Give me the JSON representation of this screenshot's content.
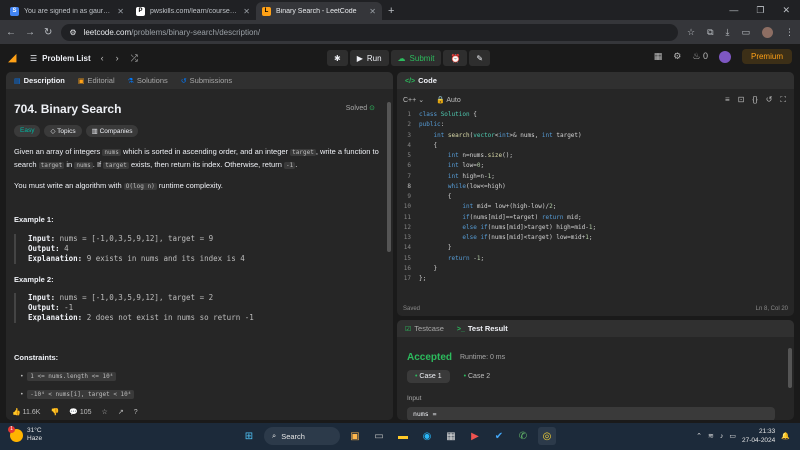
{
  "browser": {
    "tabs": [
      {
        "title": "You are signed in as gaurav.22...",
        "favicon": "S",
        "color": "#4285f4"
      },
      {
        "title": "pwskills.com/learn/course/c-with...",
        "favicon": "P",
        "color": "#ffffff"
      },
      {
        "title": "Binary Search - LeetCode",
        "favicon": "L",
        "color": "#ffa116"
      }
    ],
    "url_host": "leetcode.com",
    "url_path": "/problems/binary-search/description/"
  },
  "nav": {
    "problem_list": "Problem List",
    "run": "Run",
    "submit": "Submit",
    "notif_count": "0",
    "premium": "Premium"
  },
  "left_tabs": {
    "description": "Description",
    "editorial": "Editorial",
    "solutions": "Solutions",
    "submissions": "Submissions"
  },
  "problem": {
    "title": "704. Binary Search",
    "solved": "Solved",
    "tags": [
      "Easy",
      "Topics",
      "Companies"
    ],
    "desc_1": "Given an array of integers",
    "desc_nums": "nums",
    "desc_2": "which is sorted in ascending order, and an integer",
    "desc_target": "target",
    "desc_3": ", write a function to search",
    "desc_4": "in",
    "desc_5": ". If",
    "desc_6": "exists, then return its index. Otherwise, return",
    "desc_neg": "-1",
    "desc_end": ".",
    "desc_p2a": "You must write an algorithm with",
    "desc_big_o": "O(log n)",
    "desc_p2b": "runtime complexity.",
    "ex1_title": "Example 1:",
    "ex1_input": "nums = [-1,0,3,5,9,12], target = 9",
    "ex1_output": "4",
    "ex1_explain": "9 exists in nums and its index is 4",
    "ex2_title": "Example 2:",
    "ex2_input": "nums = [-1,0,3,5,9,12], target = 2",
    "ex2_output": "-1",
    "ex2_explain": "2 does not exist in nums so return -1",
    "label_input": "Input:",
    "label_output": "Output:",
    "label_explain": "Explanation:",
    "constraints_title": "Constraints:",
    "constraint_1": "1 <= nums.length <= 10⁴",
    "constraint_2": "-10⁴ < nums[i], target < 10⁴",
    "likes": "11.6K",
    "comments": "105"
  },
  "code_panel": {
    "title": "Code",
    "language": "C++",
    "mode": "Auto",
    "saved": "Saved",
    "cursor": "Ln 8, Col 20",
    "lines": [
      "class Solution {",
      "public:",
      "    int search(vector<int>& nums, int target)",
      "    {",
      "        int n=nums.size();",
      "        int low=0;",
      "        int high=n-1;",
      "        while(low<=high)",
      "        {",
      "            int mid= low+(high-low)/2;",
      "            if(nums[mid]==target) return mid;",
      "            else if(nums[mid]>target) high=mid-1;",
      "            else if(nums[mid]<target) low=mid+1;",
      "        }",
      "        return -1;",
      "    }",
      "};"
    ]
  },
  "test_panel": {
    "testcase": "Testcase",
    "result": "Test Result",
    "accepted": "Accepted",
    "runtime": "Runtime: 0 ms",
    "case1": "Case 1",
    "case2": "Case 2",
    "input_label": "Input",
    "input_value": "nums ="
  },
  "taskbar": {
    "temp": "31°C",
    "weather": "Haze",
    "badge": "1",
    "search": "Search",
    "time": "21:33",
    "date": "27-04-2024"
  }
}
